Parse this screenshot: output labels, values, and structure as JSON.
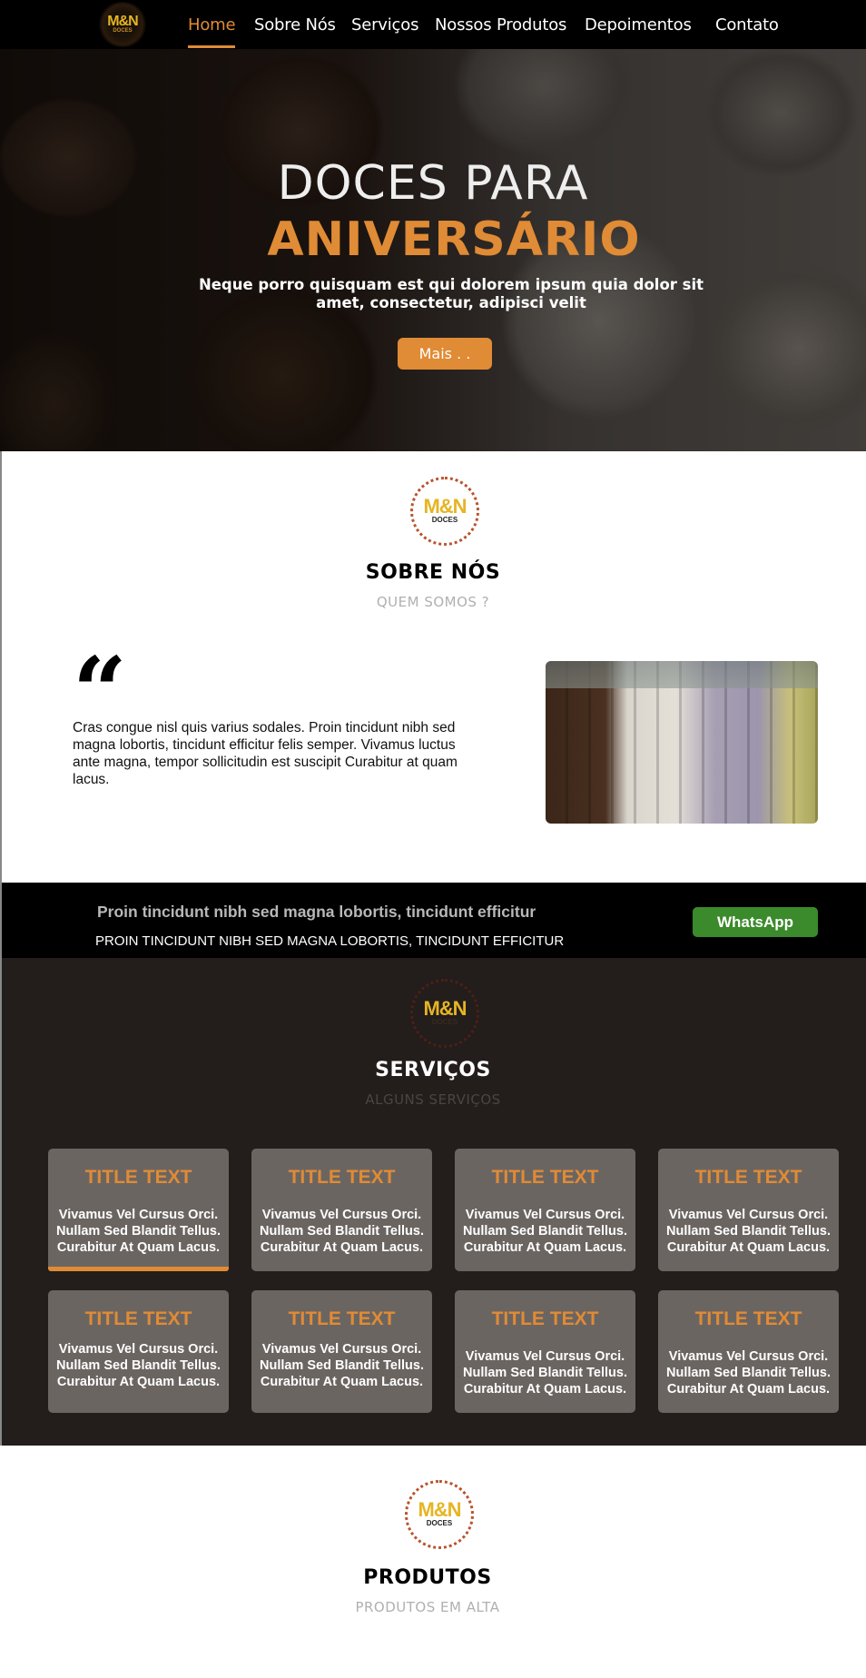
{
  "nav": {
    "logo_main": "M&N",
    "logo_sub": "DOCES",
    "items": [
      "Home",
      "Sobre Nós",
      "Serviços",
      "Nossos Produtos",
      "Depoimentos",
      "Contato"
    ]
  },
  "hero": {
    "title_line1": "DOCES PARA",
    "title_line2": "ANIVERSÁRIO",
    "subtitle": "Neque porro quisquam est qui dolorem ipsum quia dolor sit amet, consectetur, adipisci velit",
    "button": "Mais . ."
  },
  "about": {
    "logo_main": "M&N",
    "logo_sub": "DOCES",
    "title": "SOBRE NÓS",
    "subtitle": "QUEM SOMOS ?",
    "quote_mark": "“",
    "text": "Cras congue nisl quis varius sodales. Proin tincidunt nibh sed magna lobortis, tincidunt efficitur felis semper. Vivamus luctus ante magna, tempor sollicitudin est suscipit Curabitur at quam lacus."
  },
  "banner": {
    "line1": "Proin tincidunt nibh sed magna lobortis, tincidunt efficitur",
    "line2": "PROIN TINCIDUNT NIBH SED MAGNA LOBORTIS, TINCIDUNT EFFICITUR",
    "button": "WhatsApp"
  },
  "services": {
    "logo_main": "M&N",
    "logo_sub": "DOCES",
    "title": "SERVIÇOS",
    "subtitle": "ALGUNS SERVIÇOS",
    "cards": [
      {
        "title": "TITLE TEXT",
        "text": "Vivamus Vel Cursus Orci. Nullam Sed Blandit Tellus. Curabitur At Quam Lacus."
      },
      {
        "title": "TITLE TEXT",
        "text": "Vivamus Vel Cursus Orci. Nullam Sed Blandit Tellus. Curabitur At Quam Lacus."
      },
      {
        "title": "TITLE TEXT",
        "text": "Vivamus Vel Cursus Orci. Nullam Sed Blandit Tellus. Curabitur At Quam Lacus."
      },
      {
        "title": "TITLE TEXT",
        "text": "Vivamus Vel Cursus Orci. Nullam Sed Blandit Tellus. Curabitur At Quam Lacus."
      },
      {
        "title": "TITLE TEXT",
        "text": "Vivamus Vel Cursus Orci. Nullam Sed Blandit Tellus. Curabitur At Quam Lacus."
      },
      {
        "title": "TITLE TEXT",
        "text": "Vivamus Vel Cursus Orci. Nullam Sed Blandit Tellus. Curabitur At Quam Lacus."
      },
      {
        "title": "TITLE TEXT",
        "text": "Vivamus Vel Cursus Orci. Nullam Sed Blandit Tellus. Curabitur At Quam Lacus."
      },
      {
        "title": "TITLE TEXT",
        "text": "Vivamus Vel Cursus Orci. Nullam Sed Blandit Tellus. Curabitur At Quam Lacus."
      }
    ]
  },
  "products": {
    "logo_main": "M&N",
    "logo_sub": "DOCES",
    "title": "PRODUTOS",
    "subtitle": "PRODUTOS EM ALTA"
  },
  "colors": {
    "accent": "#e08b35",
    "nav_bg": "#000000",
    "services_bg": "#231d1c",
    "card_bg": "#6b6562",
    "whatsapp": "#3b8a2b"
  }
}
